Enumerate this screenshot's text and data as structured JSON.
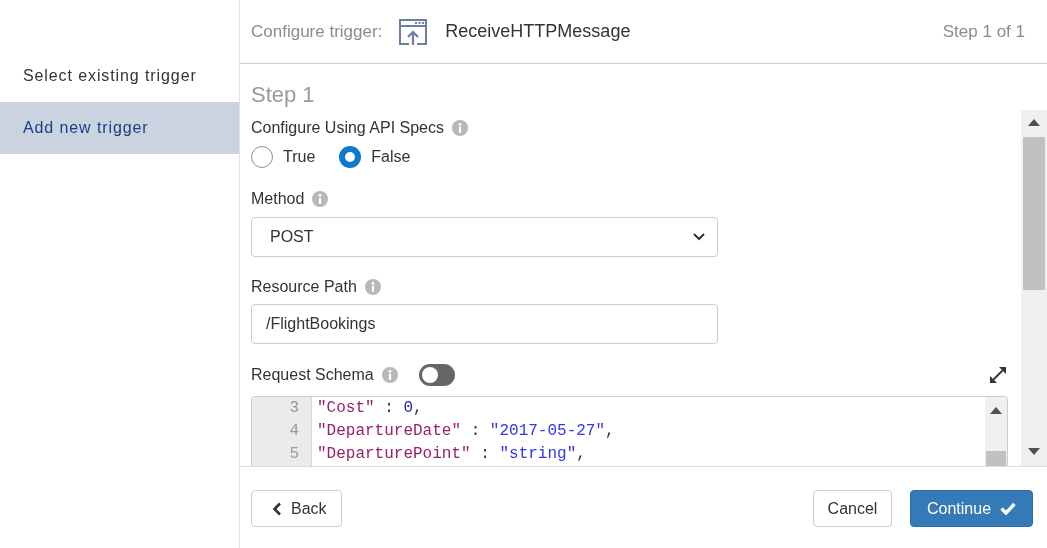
{
  "sidebar": {
    "items": [
      {
        "label": "Select existing trigger",
        "selected": false
      },
      {
        "label": "Add new trigger",
        "selected": true
      }
    ]
  },
  "header": {
    "caption": "Configure trigger:",
    "trigger_name": "ReceiveHTTPMessage",
    "step_counter": "Step 1 of 1"
  },
  "step_title": "Step 1",
  "form": {
    "api_specs": {
      "label": "Configure Using API Specs",
      "options": [
        {
          "label": "True",
          "selected": false
        },
        {
          "label": "False",
          "selected": true
        }
      ]
    },
    "method": {
      "label": "Method",
      "value": "POST"
    },
    "resource_path": {
      "label": "Resource Path",
      "value": "/FlightBookings"
    },
    "request_schema": {
      "label": "Request Schema",
      "on": false,
      "lines": [
        {
          "number": "3",
          "tokens": [
            {
              "kind": "key",
              "text": "\"Cost\""
            },
            {
              "kind": "punct",
              "text": " : "
            },
            {
              "kind": "number",
              "text": "0"
            },
            {
              "kind": "punct",
              "text": ","
            }
          ]
        },
        {
          "number": "4",
          "tokens": [
            {
              "kind": "key",
              "text": "\"DepartureDate\""
            },
            {
              "kind": "punct",
              "text": " : "
            },
            {
              "kind": "string",
              "text": "\"2017-05-27\""
            },
            {
              "kind": "punct",
              "text": ","
            }
          ]
        },
        {
          "number": "5",
          "tokens": [
            {
              "kind": "key",
              "text": "\"DeparturePoint\""
            },
            {
              "kind": "punct",
              "text": " : "
            },
            {
              "kind": "string",
              "text": "\"string\""
            },
            {
              "kind": "punct",
              "text": ","
            }
          ]
        }
      ]
    }
  },
  "footer": {
    "buttons": [
      {
        "label": "Back",
        "kind": "back"
      },
      {
        "label": "Cancel",
        "kind": "secondary"
      },
      {
        "label": "Continue",
        "kind": "primary"
      }
    ]
  }
}
